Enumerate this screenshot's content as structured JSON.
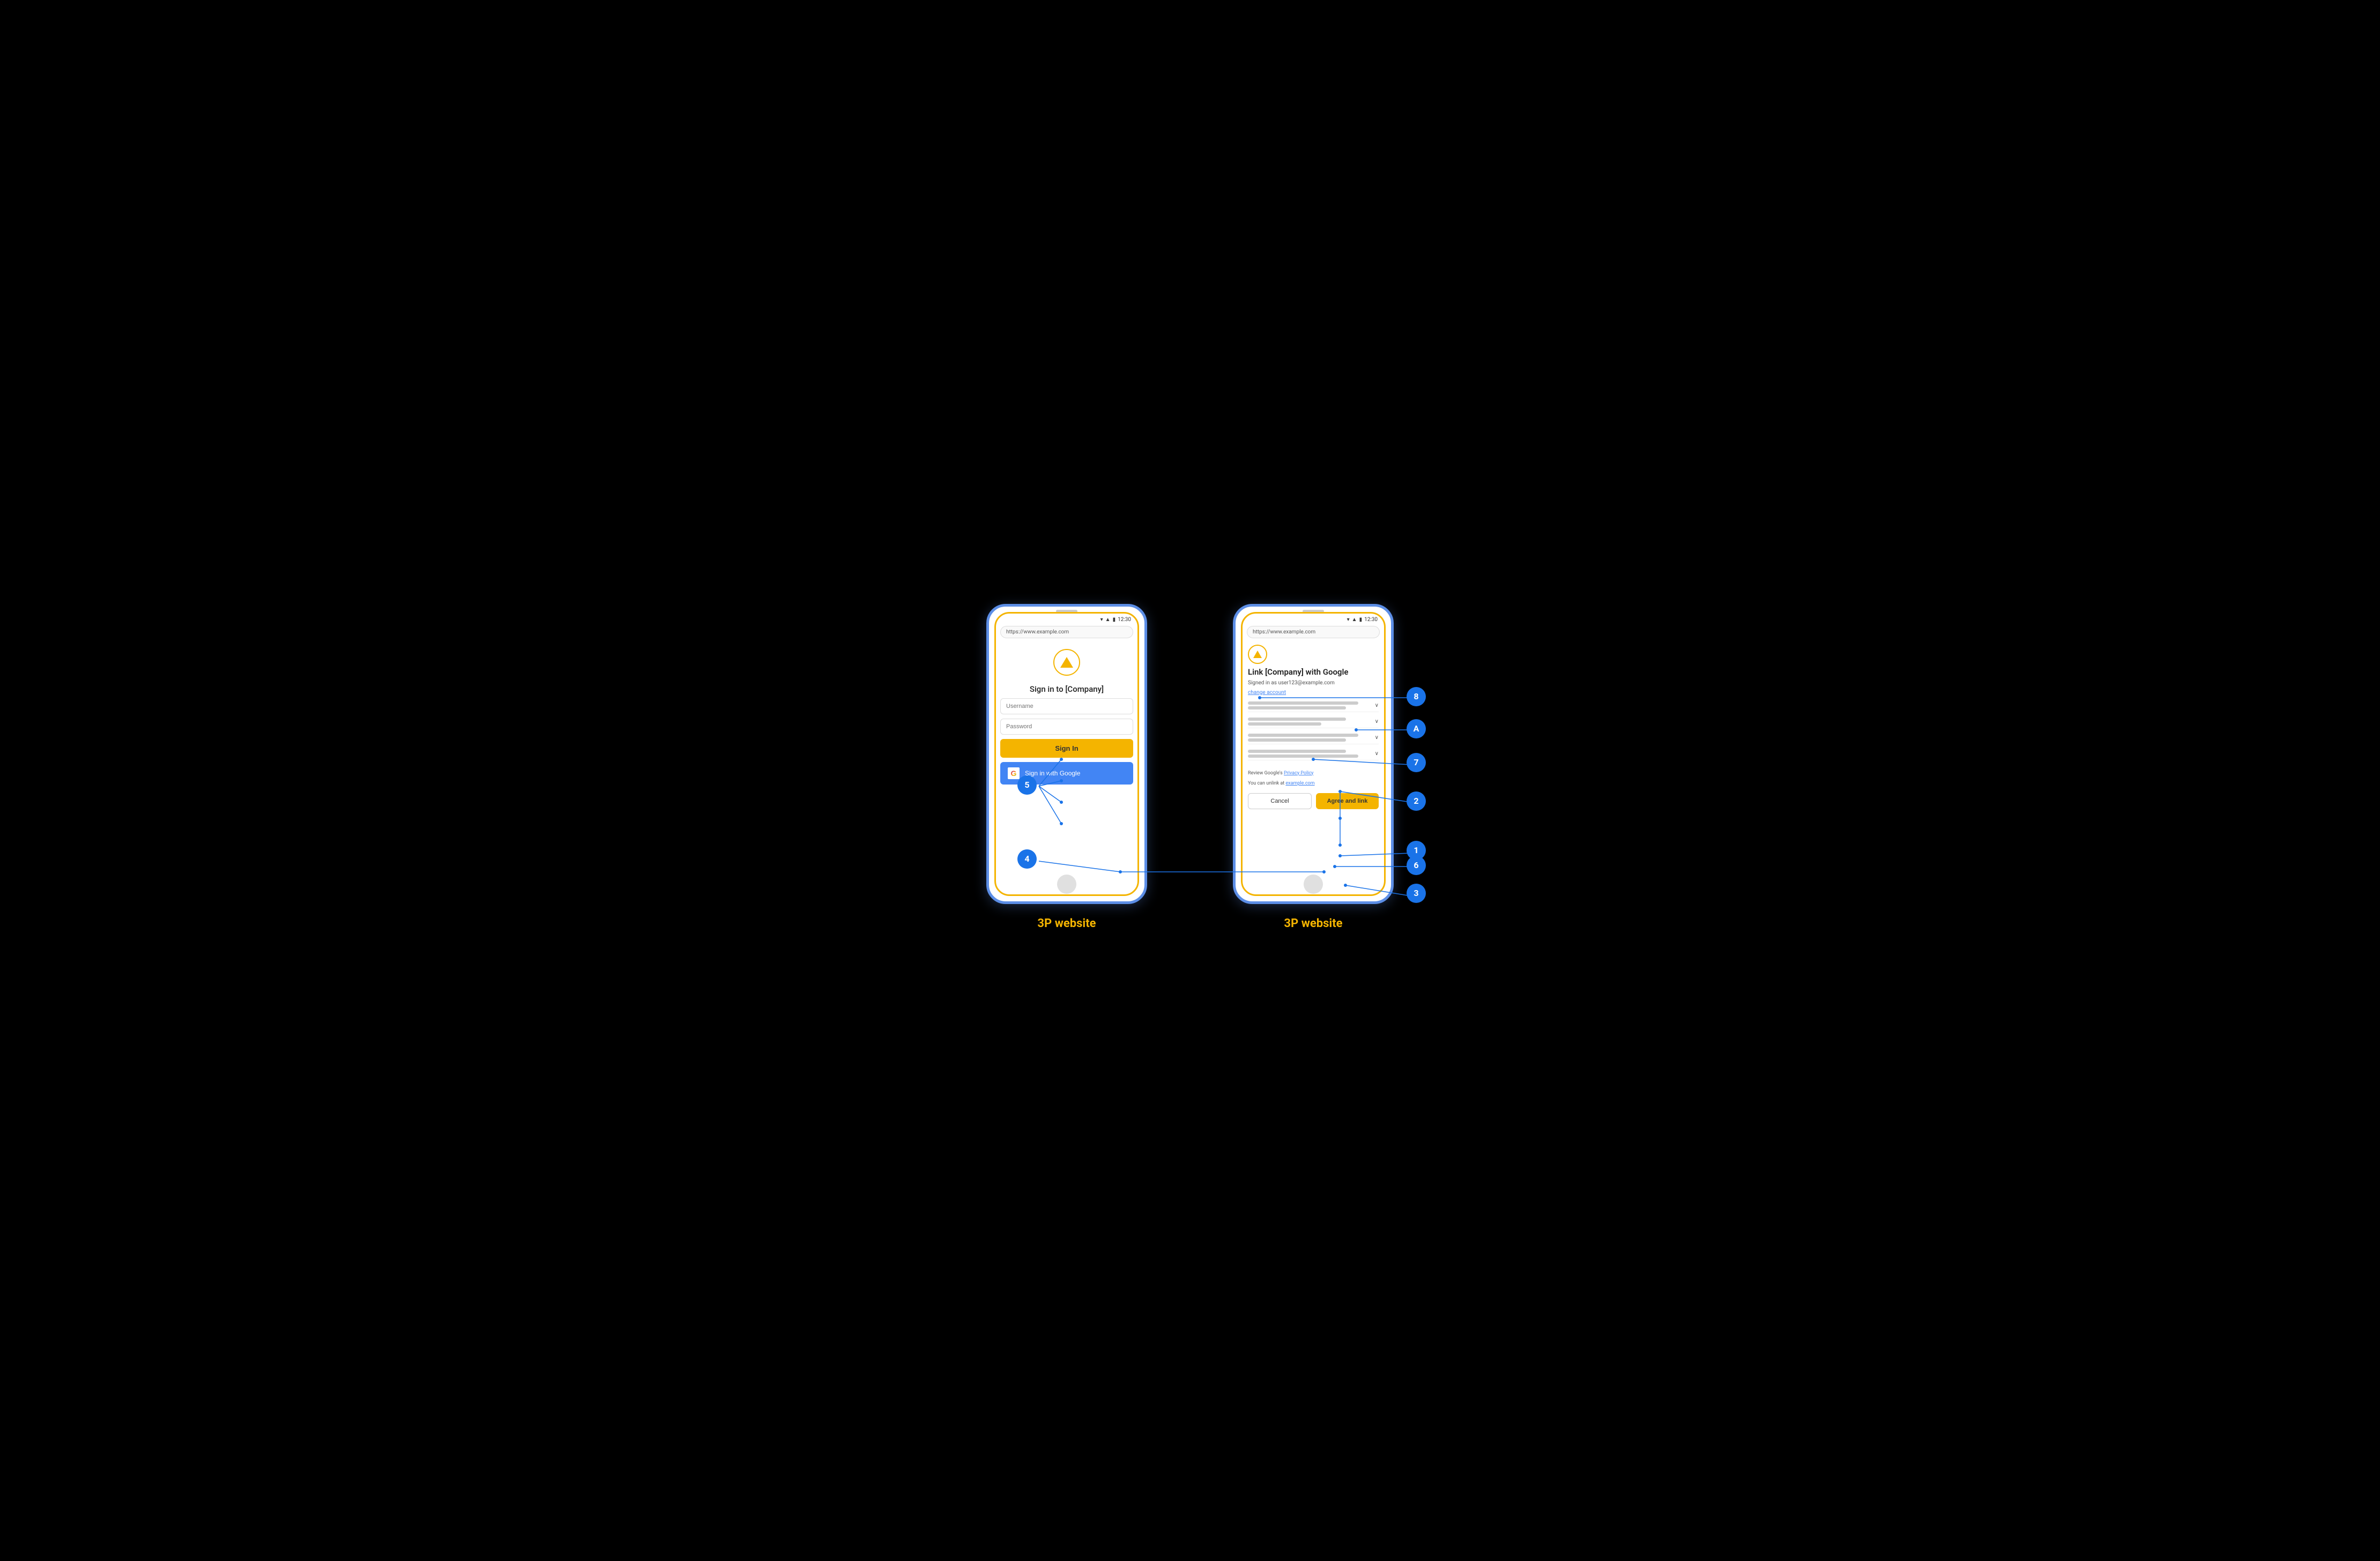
{
  "diagram": {
    "background": "#000000",
    "label_color": "#F4B400"
  },
  "phone1": {
    "label": "3P website",
    "url": "https://www.example.com",
    "status_time": "12:30",
    "logo_alt": "Company triangle logo",
    "title": "Sign in to [Company]",
    "username_placeholder": "Username",
    "password_placeholder": "Password",
    "sign_in_label": "Sign In",
    "google_btn_label": "Sign in with Google",
    "badge_5": "5",
    "badge_4": "4"
  },
  "phone2": {
    "label": "3P website",
    "url": "https://www.example.com",
    "status_time": "12:30",
    "logo_alt": "Company triangle logo",
    "title": "Link [Company] with Google",
    "signed_in_text": "Signed in as user123@example.com",
    "change_account": "change account",
    "privacy_policy_prefix": "Review Google's ",
    "privacy_policy_link": "Privacy Policy",
    "unlink_prefix": "You can unlink at ",
    "unlink_link": "example.com",
    "cancel_label": "Cancel",
    "agree_label": "Agree and link",
    "badge_8": "8",
    "badge_A": "A",
    "badge_7": "7",
    "badge_2": "2",
    "badge_1": "1",
    "badge_6": "6",
    "badge_3": "3"
  }
}
